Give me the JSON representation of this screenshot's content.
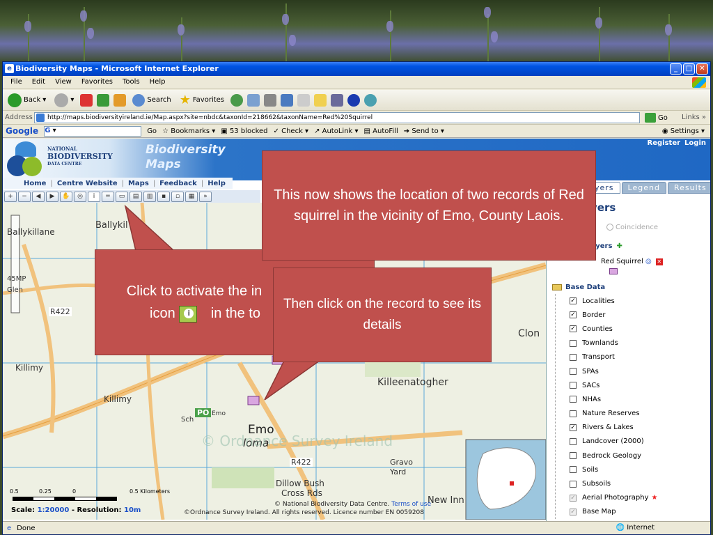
{
  "window": {
    "title": "Biodiversity Maps - Microsoft Internet Explorer",
    "buttons": {
      "minimize": "_",
      "maximize": "□",
      "close": "✕"
    }
  },
  "menu": [
    "File",
    "Edit",
    "View",
    "Favorites",
    "Tools",
    "Help"
  ],
  "toolbar": {
    "back": "Back",
    "search": "Search",
    "favorites": "Favorites"
  },
  "address": {
    "label": "Address",
    "url": "http://maps.biodiversityireland.ie/Map.aspx?site=nbdc&taxonId=218662&taxonName=Red%20Squirrel",
    "go": "Go",
    "links": "Links"
  },
  "googlebar": {
    "logo": "Google",
    "field": "G",
    "go": "Go",
    "bookmarks": "Bookmarks",
    "blocked": "53 blocked",
    "check": "Check",
    "autolink": "AutoLink",
    "autofill": "AutoFill",
    "sendto": "Send to",
    "settings": "Settings"
  },
  "site": {
    "logo": {
      "line1": "NATIONAL",
      "line2": "BIODIVERSITY",
      "line3": "DATA CENTRE"
    },
    "title_line1": "Biodiversity",
    "title_line2": "Maps",
    "register": "Register",
    "login": "Login",
    "nav": [
      "Home",
      "Centre Website",
      "Maps",
      "Feedback",
      "Help"
    ]
  },
  "panel": {
    "tabs": [
      "Layers",
      "Legend",
      "Results"
    ],
    "tab_visible_text": "yers",
    "title": "yers",
    "coincidence": "Coincidence",
    "user_layers": "s Layers",
    "record_layer": "Red Squirrel",
    "base_data": "Base Data",
    "base_items": [
      {
        "label": "Localities",
        "checked": true,
        "disabled": false
      },
      {
        "label": "Border",
        "checked": true,
        "disabled": false
      },
      {
        "label": "Counties",
        "checked": true,
        "disabled": false
      },
      {
        "label": "Townlands",
        "checked": false,
        "disabled": false
      },
      {
        "label": "Transport",
        "checked": false,
        "disabled": false
      },
      {
        "label": "SPAs",
        "checked": false,
        "disabled": false
      },
      {
        "label": "SACs",
        "checked": false,
        "disabled": false
      },
      {
        "label": "NHAs",
        "checked": false,
        "disabled": false
      },
      {
        "label": "Nature Reserves",
        "checked": false,
        "disabled": false
      },
      {
        "label": "Rivers & Lakes",
        "checked": true,
        "disabled": false
      },
      {
        "label": "Landcover (2000)",
        "checked": false,
        "disabled": false
      },
      {
        "label": "Bedrock Geology",
        "checked": false,
        "disabled": false
      },
      {
        "label": "Soils",
        "checked": false,
        "disabled": false
      },
      {
        "label": "Subsoils",
        "checked": false,
        "disabled": false
      },
      {
        "label": "Aerial Photography",
        "checked": true,
        "disabled": true
      },
      {
        "label": "Base Map",
        "checked": true,
        "disabled": true
      }
    ]
  },
  "map": {
    "labels": {
      "ballykilcavan": "Ballykil",
      "ballykillane": "Ballykillane",
      "clonagh": "Clon",
      "killimy1": "Killimy",
      "killimy2": "Killimy",
      "killeenatogher": "Killeenatogher",
      "emo": "Emo",
      "emo_italic": "Emo",
      "ioma": "loma",
      "gravo": "Gravo",
      "yard": "Yard",
      "dillow": "Dillow Bush",
      "cross": "Cross Rds",
      "newinn": "New Inn",
      "po": "PO",
      "sch": "Sch",
      "r422a": "R422",
      "r422b": "R422",
      "r445": "45MP",
      "glen": "Glen",
      "copyright_watermark": "© Ordnance Survey Ireland"
    },
    "scale_label": "Scale:",
    "scale_value": "1:20000",
    "resolution_label": "- Resolution:",
    "resolution_value": "10m",
    "scale_ticks": [
      "0.5",
      "0.25",
      "0",
      "0.5 Kilometers"
    ],
    "credit1": "© National Biodiversity Data Centre.",
    "credit1_link": "Terms of use",
    "credit2": "©Ordnance Survey Ireland. All rights reserved. Licence number EN 0059208"
  },
  "status": {
    "text": "Done",
    "zone": "Internet"
  },
  "callouts": {
    "top": "This now shows the location of two records of Red squirrel in the vicinity of Emo, County Laois.",
    "left_part1": "Click to activate the in",
    "left_part2": "icon",
    "left_part3": "in the to",
    "right": "Then click on the record to see its details"
  },
  "colors": {
    "callout": "#c0504d",
    "xp_blue": "#0054e3",
    "record": "#d9a6e0"
  }
}
